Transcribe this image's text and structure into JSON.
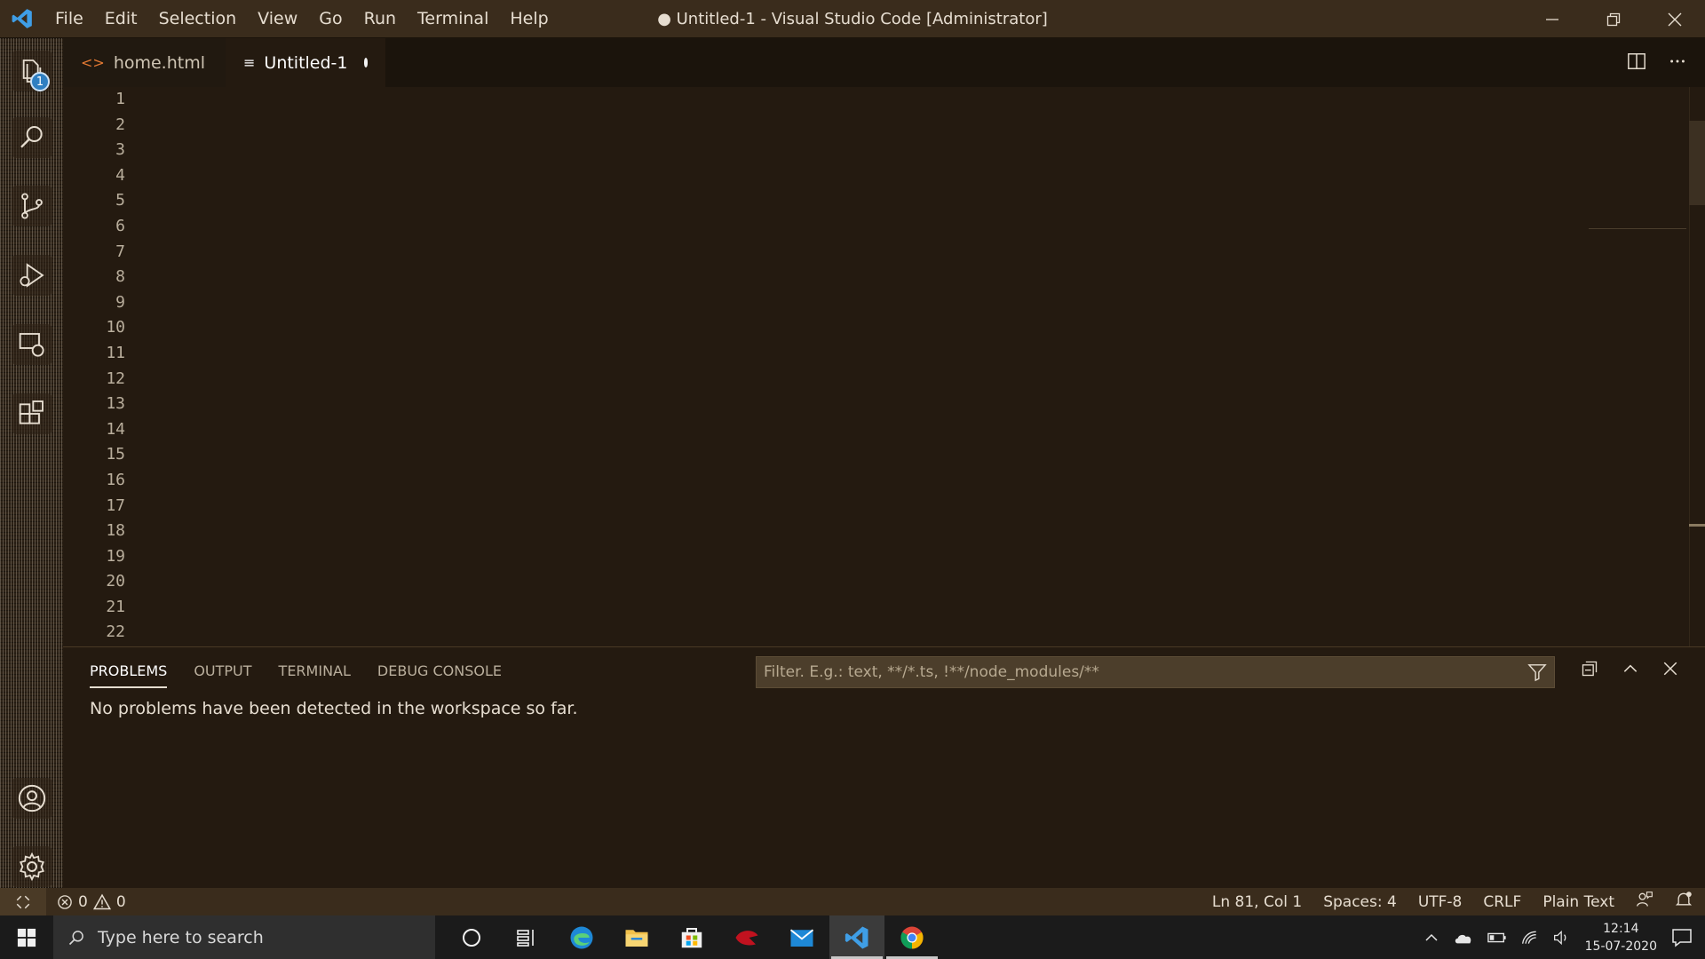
{
  "titlebar": {
    "menus": [
      "File",
      "Edit",
      "Selection",
      "View",
      "Go",
      "Run",
      "Terminal",
      "Help"
    ],
    "window_title": "● Untitled-1 - Visual Studio Code [Administrator]"
  },
  "activity": {
    "explorer_badge": "1"
  },
  "tabs": [
    {
      "label": "home.html",
      "icon": "html-code-icon",
      "active": false
    },
    {
      "label": "Untitled-1",
      "icon": "plain-text-icon",
      "active": true,
      "dirty": true
    }
  ],
  "editor": {
    "line_numbers": [
      "1",
      "2",
      "3",
      "4",
      "5",
      "6",
      "7",
      "8",
      "9",
      "10",
      "11",
      "12",
      "13",
      "14",
      "15",
      "16",
      "17",
      "18",
      "19",
      "20",
      "21",
      "22"
    ]
  },
  "panel": {
    "tabs": [
      "PROBLEMS",
      "OUTPUT",
      "TERMINAL",
      "DEBUG CONSOLE"
    ],
    "active_tab": "PROBLEMS",
    "filter_placeholder": "Filter. E.g.: text, **/*.ts, !**/node_modules/**",
    "message": "No problems have been detected in the workspace so far."
  },
  "statusbar": {
    "errors": "0",
    "warnings": "0",
    "position": "Ln 81, Col 1",
    "spaces": "Spaces: 4",
    "encoding": "UTF-8",
    "eol": "CRLF",
    "language": "Plain Text"
  },
  "taskbar": {
    "search_placeholder": "Type here to search",
    "time": "12:14",
    "date": "15-07-2020"
  },
  "colors": {
    "editor_bg": "#241a10",
    "titlebar_bg": "#3a2c1c",
    "badge": "#2f7fc1",
    "html_icon": "#e37933"
  }
}
